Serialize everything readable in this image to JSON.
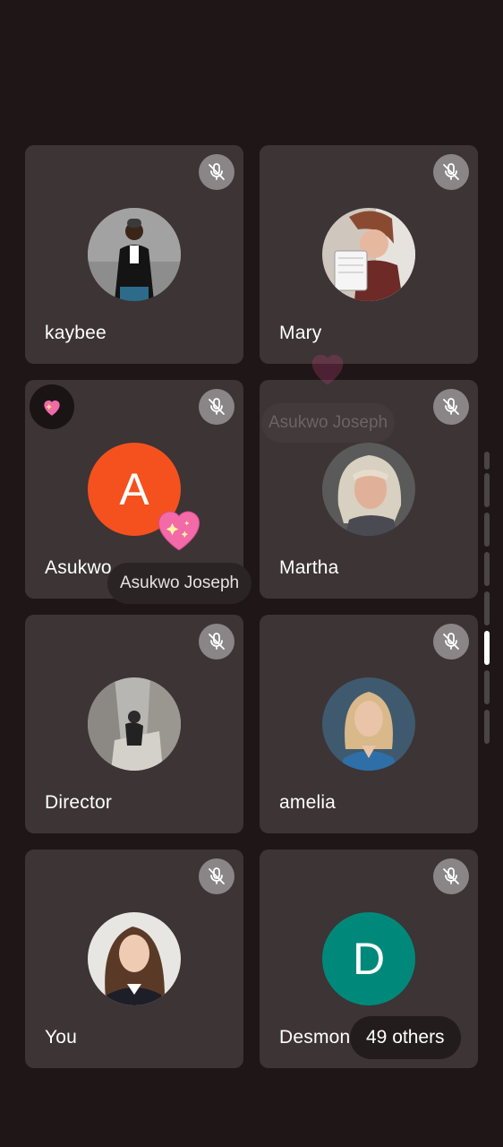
{
  "participants": [
    {
      "name": "kaybee",
      "muted": true,
      "avatar": "photo"
    },
    {
      "name": "Mary",
      "muted": true,
      "avatar": "photo"
    },
    {
      "name": "Asukwo",
      "muted": true,
      "avatar": "letter",
      "letter": "A",
      "color": "#f4511e"
    },
    {
      "name": "Martha",
      "muted": true,
      "avatar": "photo"
    },
    {
      "name": "Director",
      "muted": true,
      "avatar": "photo"
    },
    {
      "name": "amelia",
      "muted": true,
      "avatar": "photo"
    },
    {
      "name": "You",
      "muted": true,
      "avatar": "photo"
    },
    {
      "name": "Desmond",
      "muted": true,
      "avatar": "letter",
      "letter": "D",
      "color": "#00897b"
    }
  ],
  "reaction": {
    "sender": "Asukwo Joseph",
    "emoji": "sparkling-heart",
    "faded_sender": "Asukwo Joseph"
  },
  "others_count_label": "49 others",
  "colors": {
    "background": "#1e1617",
    "tile": "#3c3435",
    "mute_badge": "#8a8587"
  },
  "icons": {
    "mute": "mic-off-icon",
    "reaction": "sparkling-heart-icon"
  }
}
